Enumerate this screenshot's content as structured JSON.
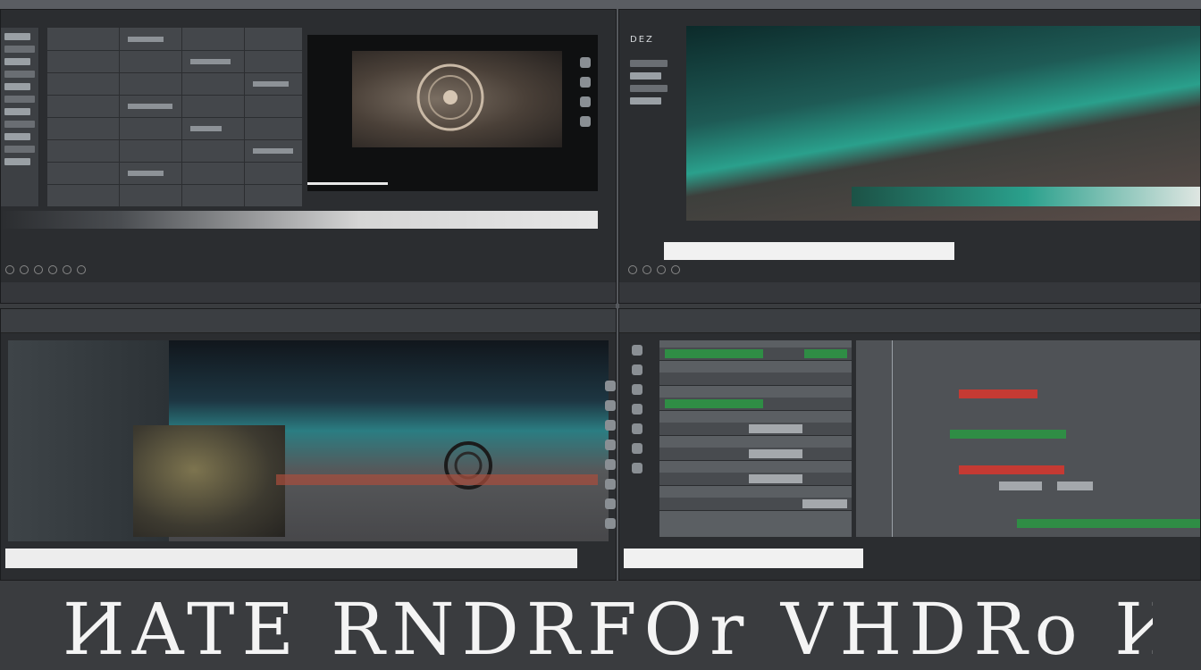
{
  "colors": {
    "background": "#3a3c3f",
    "panel": "#2b2d30",
    "accent_green": "#2f8d45",
    "accent_red": "#c53a33",
    "accent_teal": "#2aa08c"
  },
  "top_right": {
    "header_label": "DEZ"
  },
  "bottom_title": {
    "text": "ИATE RNDRFΟr VHDRo  ИИITE"
  },
  "icons": {
    "play": "play-icon",
    "stop": "stop-icon",
    "loop": "loop-icon",
    "marker": "marker-icon"
  }
}
